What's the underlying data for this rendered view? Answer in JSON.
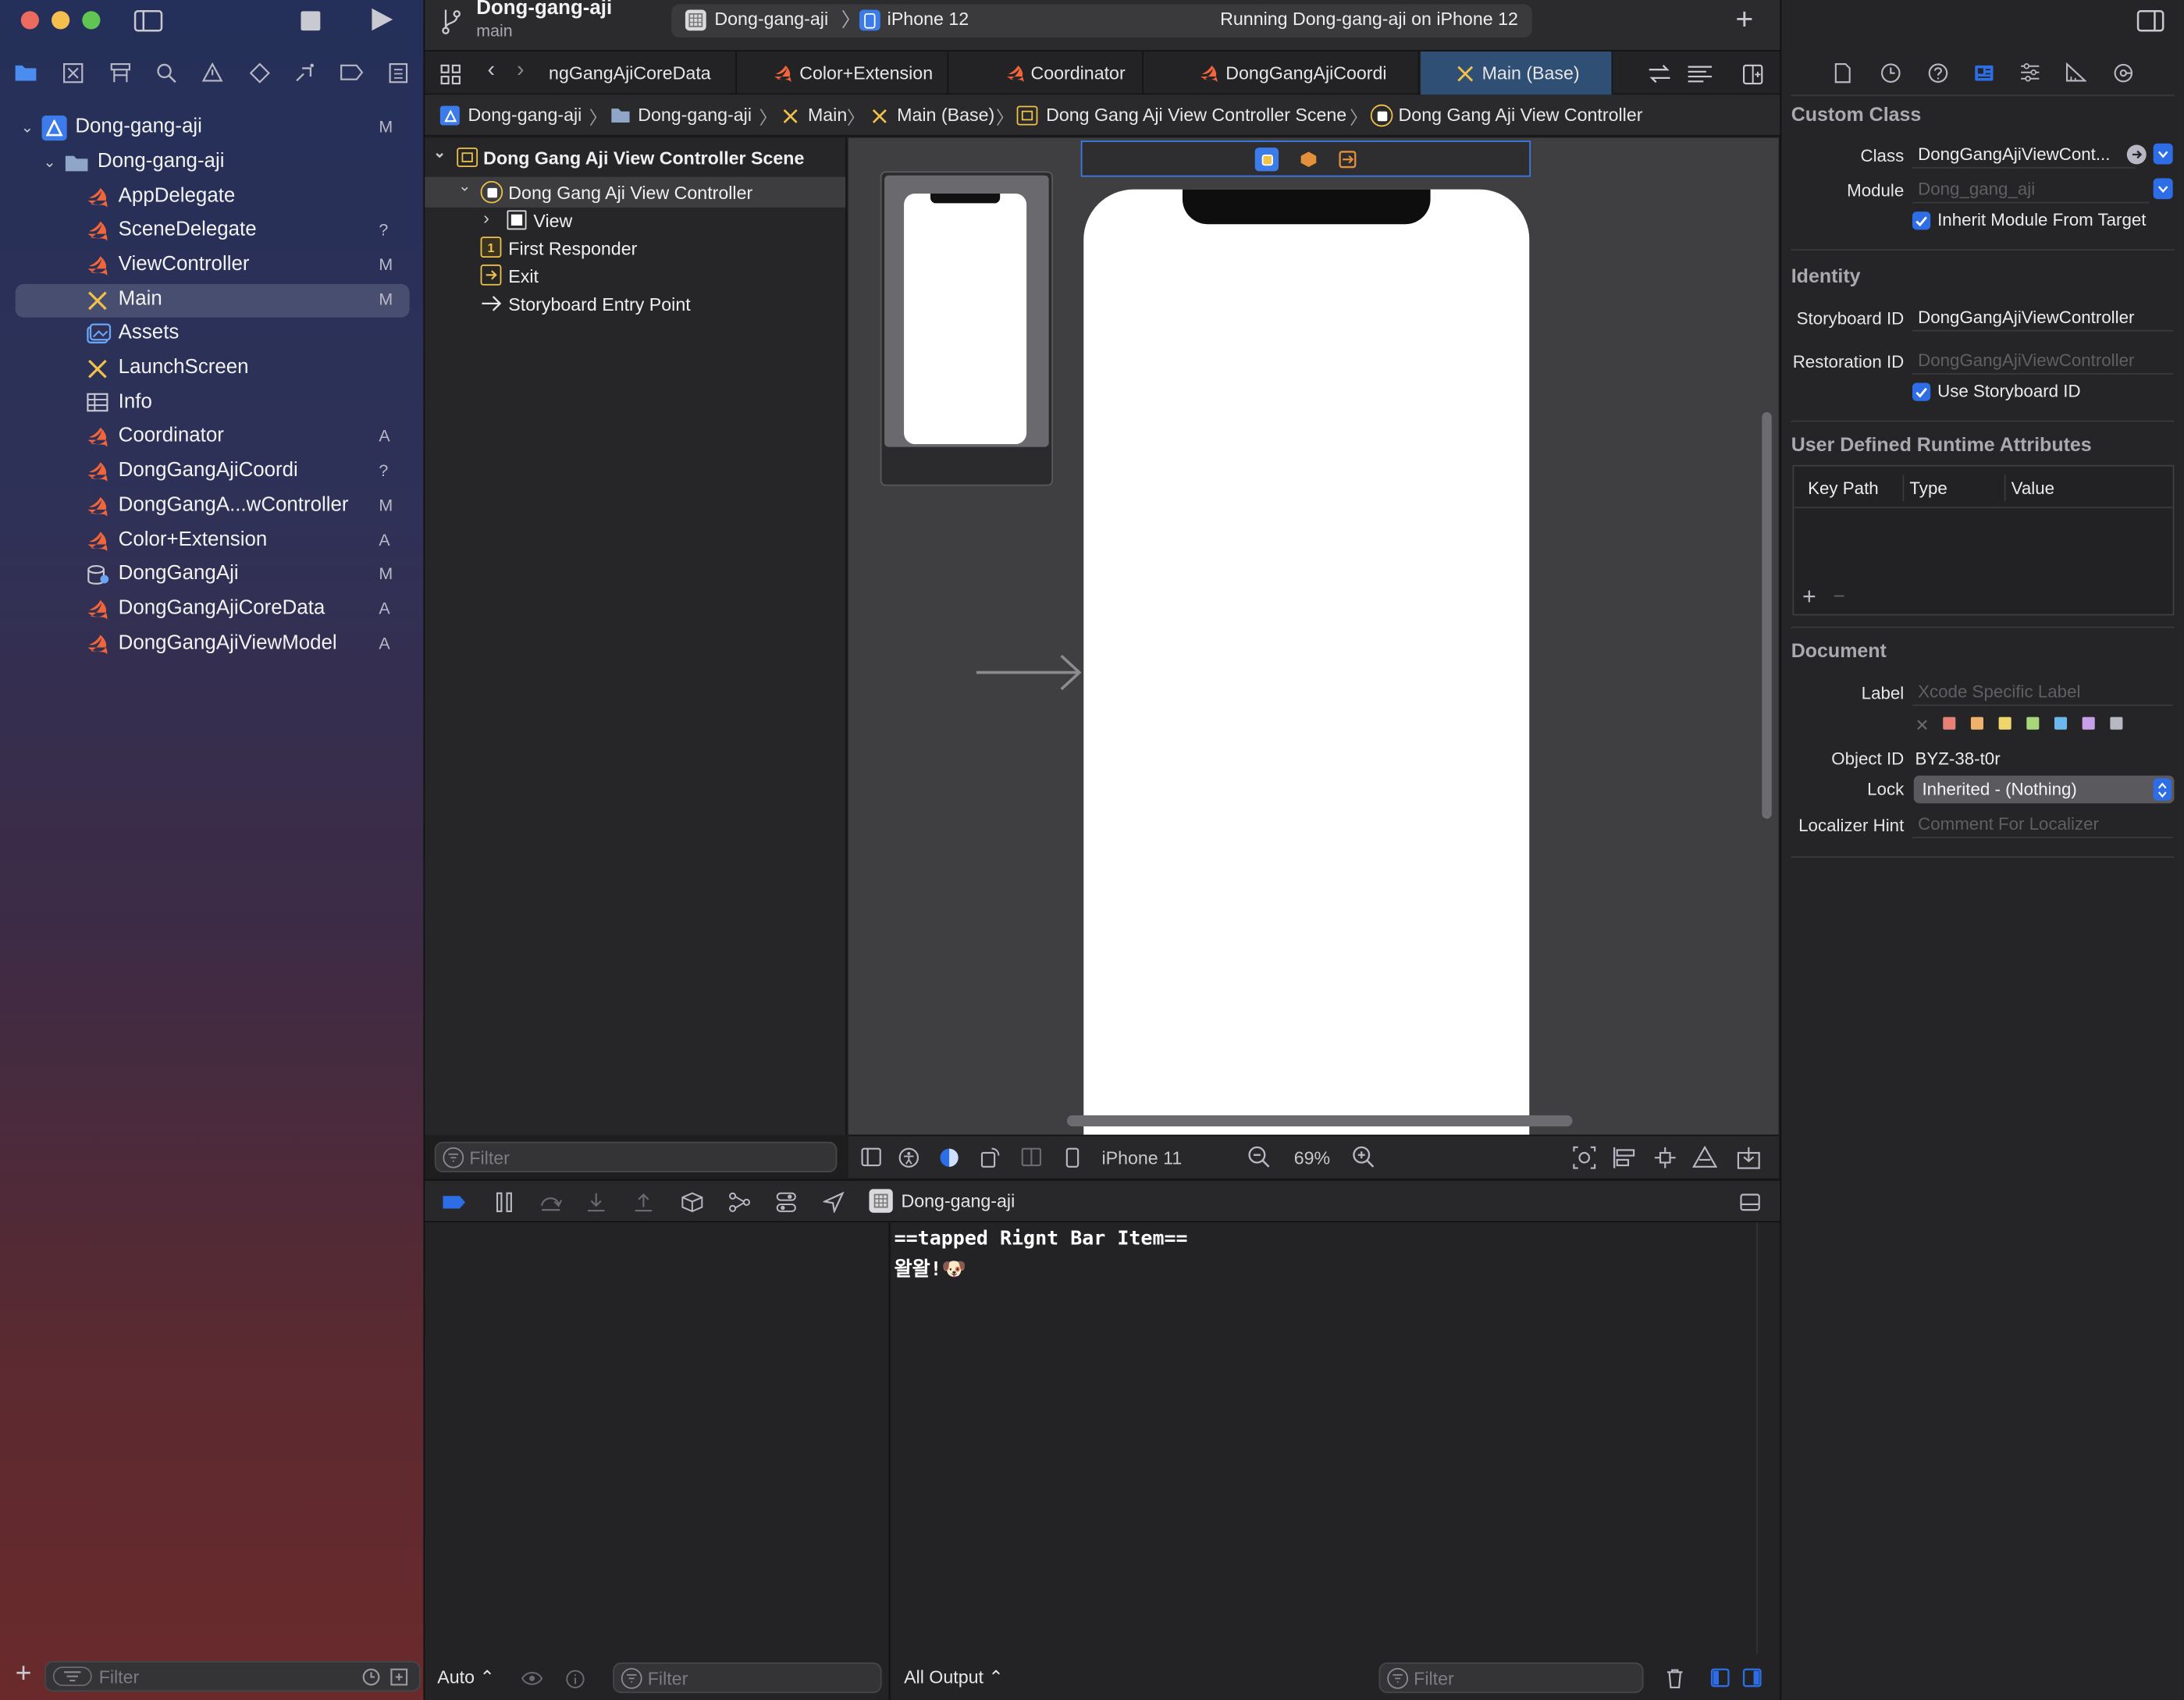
{
  "window": {
    "project_title": "Dong-gang-aji",
    "branch": "main",
    "scheme": "Dong-gang-aji",
    "device": "iPhone 12",
    "status": "Running Dong-gang-aji on iPhone 12"
  },
  "sidebar": {
    "items": [
      {
        "label": "Dong-gang-aji",
        "status": "M",
        "kind": "project"
      },
      {
        "label": "Dong-gang-aji",
        "status": "",
        "kind": "folder"
      },
      {
        "label": "AppDelegate",
        "status": "",
        "kind": "swift"
      },
      {
        "label": "SceneDelegate",
        "status": "?",
        "kind": "swift"
      },
      {
        "label": "ViewController",
        "status": "M",
        "kind": "swift"
      },
      {
        "label": "Main",
        "status": "M",
        "kind": "storyboard"
      },
      {
        "label": "Assets",
        "status": "",
        "kind": "assets"
      },
      {
        "label": "LaunchScreen",
        "status": "",
        "kind": "storyboard"
      },
      {
        "label": "Info",
        "status": "",
        "kind": "plist"
      },
      {
        "label": "Coordinator",
        "status": "A",
        "kind": "swift"
      },
      {
        "label": "DongGangAjiCoordi",
        "status": "?",
        "kind": "swift"
      },
      {
        "label": "DongGangA...wController",
        "status": "M",
        "kind": "swift"
      },
      {
        "label": "Color+Extension",
        "status": "A",
        "kind": "swift"
      },
      {
        "label": "DongGangAji",
        "status": "M",
        "kind": "coredata"
      },
      {
        "label": "DongGangAjiCoreData",
        "status": "A",
        "kind": "swift"
      },
      {
        "label": "DongGangAjiViewModel",
        "status": "A",
        "kind": "swift"
      }
    ],
    "filter_placeholder": "Filter"
  },
  "tabs": [
    {
      "label": "ngGangAjiCoreData",
      "kind": "swift"
    },
    {
      "label": "Color+Extension",
      "kind": "swift"
    },
    {
      "label": "Coordinator",
      "kind": "swift"
    },
    {
      "label": "DongGangAjiCoordi",
      "kind": "swift"
    },
    {
      "label": "Main (Base)",
      "kind": "storyboard"
    }
  ],
  "jumpbar": [
    "Dong-gang-aji",
    "Dong-gang-aji",
    "Main",
    "Main (Base)",
    "Dong Gang Aji View Controller Scene",
    "Dong Gang Aji View Controller"
  ],
  "outline": {
    "scene": "Dong Gang Aji View Controller Scene",
    "controller": "Dong Gang Aji View Controller",
    "view": "View",
    "first_responder": "First Responder",
    "exit": "Exit",
    "entry_point": "Storyboard Entry Point",
    "filter_placeholder": "Filter"
  },
  "canvas_bar": {
    "device": "iPhone 11",
    "zoom": "69%"
  },
  "debug": {
    "target": "Dong-gang-aji",
    "console_lines": [
      "==tapped Rignt Bar Item==",
      "왈왈!🐶"
    ],
    "auto_label": "Auto",
    "filter_placeholder": "Filter",
    "output_label": "All Output",
    "console_filter_placeholder": "Filter"
  },
  "inspector": {
    "custom_class_title": "Custom Class",
    "class_label": "Class",
    "class_value": "DongGangAjiViewCont...",
    "module_label": "Module",
    "module_placeholder": "Dong_gang_aji",
    "inherit_label": "Inherit Module From Target",
    "identity_title": "Identity",
    "storyboard_id_label": "Storyboard ID",
    "storyboard_id_value": "DongGangAjiViewController",
    "restoration_id_label": "Restoration ID",
    "restoration_id_placeholder": "DongGangAjiViewController",
    "use_storyboard_id_label": "Use Storyboard ID",
    "runtime_title": "User Defined Runtime Attributes",
    "col_keypath": "Key Path",
    "col_type": "Type",
    "col_value": "Value",
    "document_title": "Document",
    "label_label": "Label",
    "label_placeholder": "Xcode Specific Label",
    "object_id_label": "Object ID",
    "object_id_value": "BYZ-38-t0r",
    "lock_label": "Lock",
    "lock_value": "Inherited - (Nothing)",
    "localizer_label": "Localizer Hint",
    "localizer_placeholder": "Comment For Localizer",
    "label_colors": [
      "#e8807a",
      "#f0b26a",
      "#efd66b",
      "#a8d67a",
      "#6cb8ee",
      "#c7a0e8",
      "#b8b8c4"
    ]
  },
  "colors": {
    "accent": "#2d6ee6",
    "swift": "#f0653a",
    "storyboard": "#f0c24a",
    "selected_tab": "#2f4f74"
  }
}
